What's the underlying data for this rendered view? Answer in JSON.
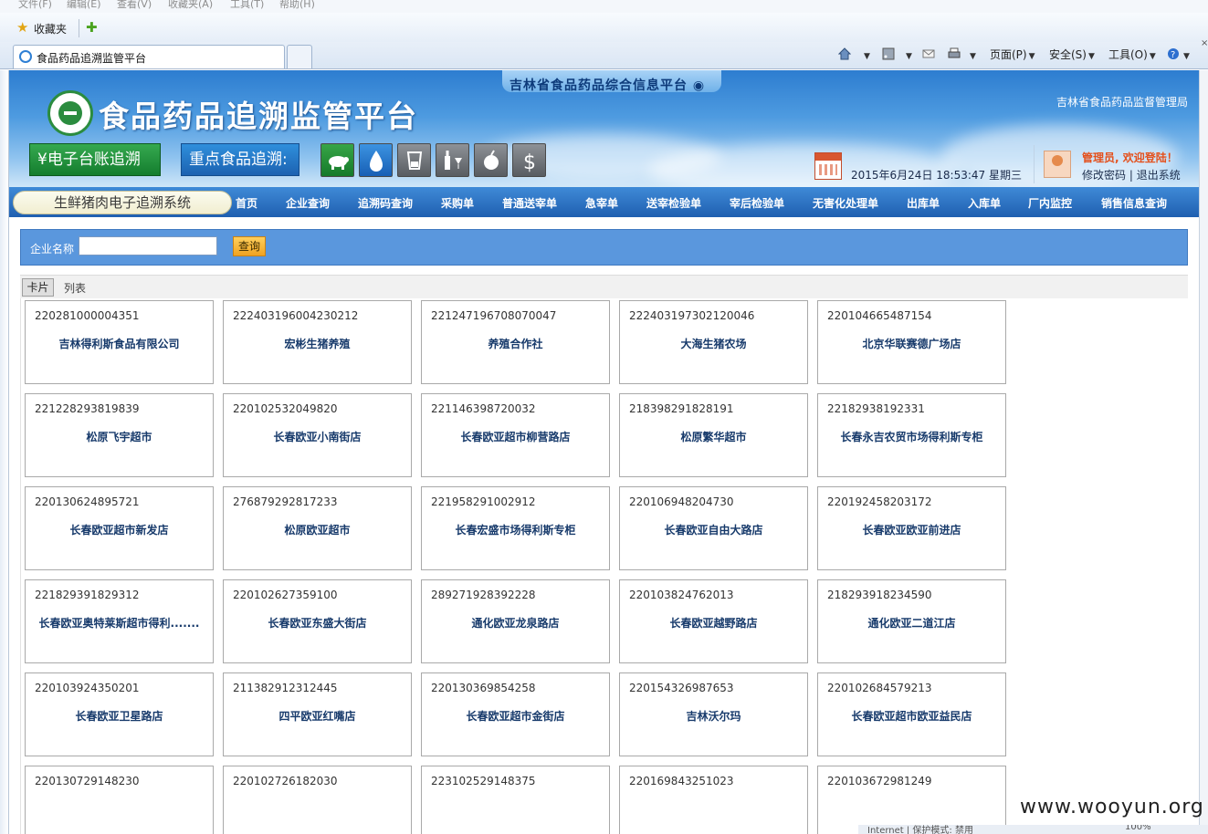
{
  "browser": {
    "menu": [
      "文件(F)",
      "编辑(E)",
      "查看(V)",
      "收藏夹(A)",
      "工具(T)",
      "帮助(H)"
    ],
    "favorites_label": "收藏夹",
    "tab_title": "食品药品追溯监管平台",
    "commands": {
      "page": "页面(P)",
      "safety": "安全(S)",
      "tools": "工具(O)"
    },
    "status": {
      "mode": "Internet | 保护模式: 禁用",
      "zoom": "100%"
    }
  },
  "header": {
    "portal_name": "吉林省食品药品综合信息平台",
    "site_title": "食品药品追溯监管平台",
    "agency": "吉林省食品药品监督管理局",
    "ledger_button": "¥电子台账追溯",
    "key_food_button": "重点食品追溯:",
    "food_icons": [
      "pig-icon",
      "milk-drop-icon",
      "liquor-glass-icon",
      "wine-icon",
      "fruit-icon",
      "dollar-icon"
    ],
    "datetime": "2015年6月24日 18:53:47 星期三",
    "welcome": "管理员, 欢迎登陆！",
    "change_password": "修改密码",
    "separator": "|",
    "logout": "退出系统"
  },
  "nav": {
    "system_name": "生鲜猪肉电子追溯系统",
    "items": [
      "首页",
      "企业查询",
      "追溯码查询",
      "采购单",
      "普通送宰单",
      "急宰单",
      "送宰检验单",
      "宰后检验单",
      "无害化处理单",
      "出库单",
      "入库单",
      "厂内监控",
      "销售信息查询"
    ]
  },
  "search": {
    "label": "企业名称",
    "value": "",
    "button": "查询"
  },
  "views": {
    "card": "卡片",
    "list": "列表"
  },
  "cards": [
    {
      "code": "220281000004351",
      "name": "吉林得利斯食品有限公司"
    },
    {
      "code": "222403196004230212",
      "name": "宏彬生猪养殖"
    },
    {
      "code": "221247196708070047",
      "name": "养殖合作社"
    },
    {
      "code": "222403197302120046",
      "name": "大海生猪农场"
    },
    {
      "code": "220104665487154",
      "name": "北京华联赛德广场店"
    },
    {
      "code": "221228293819839",
      "name": "松原飞宇超市"
    },
    {
      "code": "220102532049820",
      "name": "长春欧亚小南街店"
    },
    {
      "code": "221146398720032",
      "name": "长春欧亚超市柳营路店"
    },
    {
      "code": "218398291828191",
      "name": "松原繁华超市"
    },
    {
      "code": "221829381923 31",
      "name": "长春永吉农贸市场得利斯专柜"
    },
    {
      "code": "220130624895721",
      "name": "长春欧亚超市新发店"
    },
    {
      "code": "276879292817233",
      "name": "松原欧亚超市"
    },
    {
      "code": "221958291002912",
      "name": "长春宏盛市场得利斯专柜"
    },
    {
      "code": "220106948204730",
      "name": "长春欧亚自由大路店"
    },
    {
      "code": "220192458203172",
      "name": "长春欧亚欧亚前进店"
    },
    {
      "code": "221829391829312",
      "name": "长春欧亚奥特莱斯超市得利......."
    },
    {
      "code": "220102627359100",
      "name": "长春欧亚东盛大街店"
    },
    {
      "code": "289271928392228",
      "name": "通化欧亚龙泉路店"
    },
    {
      "code": "220103824762013",
      "name": "长春欧亚越野路店"
    },
    {
      "code": "218293918234590",
      "name": "通化欧亚二道江店"
    },
    {
      "code": "220103924350201",
      "name": "长春欧亚卫星路店"
    },
    {
      "code": "211382912312445",
      "name": "四平欧亚红嘴店"
    },
    {
      "code": "220130369854258",
      "name": "长春欧亚超市金街店"
    },
    {
      "code": "220154326987653",
      "name": "吉林沃尔玛"
    },
    {
      "code": "220102684579213",
      "name": "长春欧亚超市欧亚益民店"
    },
    {
      "code": "220130729148230",
      "name": ""
    },
    {
      "code": "220102726182030",
      "name": ""
    },
    {
      "code": "223102529148375",
      "name": ""
    },
    {
      "code": "220169843251023",
      "name": ""
    },
    {
      "code": "220103672981249",
      "name": ""
    }
  ],
  "watermark": "www.wooyun.org"
}
